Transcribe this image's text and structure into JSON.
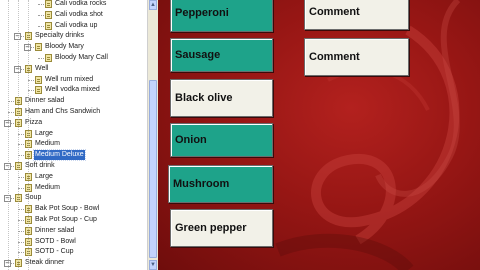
{
  "tree": {
    "items": [
      {
        "label": "Cali vodka rocks",
        "level": 4,
        "toggle": ""
      },
      {
        "label": "Cali vodka shot",
        "level": 4,
        "toggle": ""
      },
      {
        "label": "Cali vodka up",
        "level": 4,
        "toggle": ""
      },
      {
        "label": "Specialty drinks",
        "level": 2,
        "toggle": "−"
      },
      {
        "label": "Bloody Mary",
        "level": 3,
        "toggle": "−"
      },
      {
        "label": "Bloody Mary Call",
        "level": 4,
        "toggle": ""
      },
      {
        "label": "Well",
        "level": 2,
        "toggle": "−"
      },
      {
        "label": "Well rum mixed",
        "level": 3,
        "toggle": ""
      },
      {
        "label": "Well vodka mixed",
        "level": 3,
        "toggle": ""
      },
      {
        "label": "Dinner salad",
        "level": 1,
        "toggle": ""
      },
      {
        "label": "Ham and Chs Sandwich",
        "level": 1,
        "toggle": ""
      },
      {
        "label": "Pizza",
        "level": 1,
        "toggle": "−"
      },
      {
        "label": "Large",
        "level": 2,
        "toggle": ""
      },
      {
        "label": "Medium",
        "level": 2,
        "toggle": ""
      },
      {
        "label": "Medium Deluxe",
        "level": 2,
        "toggle": "",
        "selected": true
      },
      {
        "label": "Soft drink",
        "level": 1,
        "toggle": "−"
      },
      {
        "label": "Large",
        "level": 2,
        "toggle": ""
      },
      {
        "label": "Medium",
        "level": 2,
        "toggle": ""
      },
      {
        "label": "Soup",
        "level": 1,
        "toggle": "−"
      },
      {
        "label": "Bak Pot Soup - Bowl",
        "level": 2,
        "toggle": ""
      },
      {
        "label": "Bak Pot Soup - Cup",
        "level": 2,
        "toggle": ""
      },
      {
        "label": "Dinner salad",
        "level": 2,
        "toggle": ""
      },
      {
        "label": "SOTD - Bowl",
        "level": 2,
        "toggle": ""
      },
      {
        "label": "SOTD - Cup",
        "level": 2,
        "toggle": ""
      },
      {
        "label": "Steak dinner",
        "level": 1,
        "toggle": "−"
      }
    ]
  },
  "modifiers": [
    {
      "label": "Pepperoni",
      "color": "green"
    },
    {
      "label": "Sausage",
      "color": "green"
    },
    {
      "label": "Black olive",
      "color": "cream"
    },
    {
      "label": "Onion",
      "color": "green"
    },
    {
      "label": "Mushroom",
      "color": "green"
    },
    {
      "label": "Green pepper",
      "color": "cream"
    }
  ],
  "comments": [
    {
      "label": "Comment"
    },
    {
      "label": "Comment"
    }
  ],
  "colors": {
    "accent_green": "#1ea38a",
    "cream": "#f2f1e8",
    "background_red": "#961614",
    "selection_blue": "#316ac5"
  }
}
